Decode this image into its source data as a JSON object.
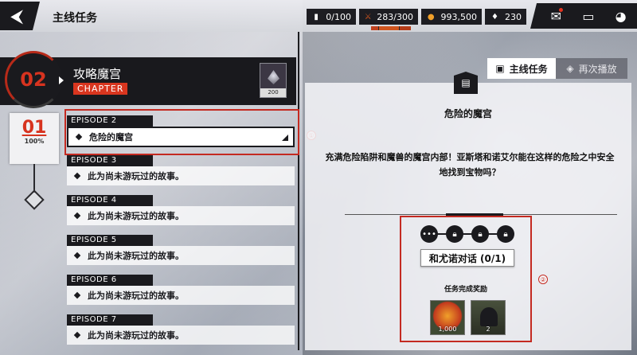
{
  "header": {
    "back_icon": "back-arrow-icon",
    "title": "主线任务"
  },
  "resources": [
    {
      "icon": "card-icon",
      "value": "0/100"
    },
    {
      "icon": "stamina-icon",
      "value": "283/300"
    },
    {
      "icon": "gold-coin-icon",
      "value": "993,500"
    },
    {
      "icon": "gem-icon",
      "value": "230"
    }
  ],
  "top_icons": [
    "mail-icon",
    "chat-icon",
    "settings-icon"
  ],
  "chapter": {
    "number": "02",
    "title": "攻略魔宫",
    "tag": "CHAPTER",
    "reward_count": "200"
  },
  "stage": {
    "number": "01",
    "percent": "100%"
  },
  "episodes": [
    {
      "label": "EPISODE 2",
      "title": "危险的魔宫"
    },
    {
      "label": "EPISODE 3",
      "title": "此为尚未游玩过的故事。"
    },
    {
      "label": "EPISODE 4",
      "title": "此为尚未游玩过的故事。"
    },
    {
      "label": "EPISODE 5",
      "title": "此为尚未游玩过的故事。"
    },
    {
      "label": "EPISODE 6",
      "title": "此为尚未游玩过的故事。"
    },
    {
      "label": "EPISODE 7",
      "title": "此为尚未游玩过的故事。"
    }
  ],
  "markers": {
    "one": "①",
    "two": "②"
  },
  "tabs": {
    "main": "主线任务",
    "replay": "再次播放"
  },
  "info": {
    "title": "危险的魔宫",
    "description": "充满危险陷阱和魔兽的魔宫内部！亚斯塔和诺艾尔能在这样的危险之中安全地找到宝物吗？",
    "mission_button": "和尤诺对话 (0/1)",
    "reward_title": "任务完成奖励",
    "rewards": [
      {
        "icon": "gold-coin-icon",
        "count": "1,000"
      },
      {
        "icon": "character-icon",
        "count": "2"
      }
    ]
  }
}
